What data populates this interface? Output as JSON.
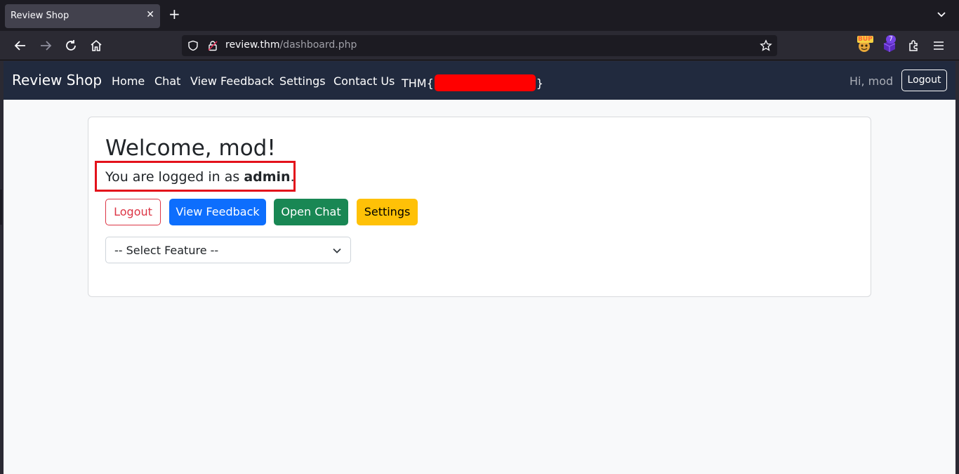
{
  "browser": {
    "tab_title": "Review Shop",
    "url_host": "review.thm",
    "url_path": "/dashboard.php",
    "extension_badge_count": "7",
    "extension_label": "BUP"
  },
  "navbar": {
    "brand": "Review Shop",
    "links": [
      "Home",
      "Chat",
      "View Feedback",
      "Settings",
      "Contact Us"
    ],
    "flag_prefix": "THM{",
    "flag_suffix": "}",
    "greeting": "Hi, mod",
    "logout_label": "Logout"
  },
  "dashboard": {
    "welcome": "Welcome, mod!",
    "logged_prefix": "You are logged in as ",
    "role": "admin",
    "logged_suffix": ".",
    "buttons": {
      "logout": "Logout",
      "view_feedback": "View Feedback",
      "open_chat": "Open Chat",
      "settings": "Settings"
    },
    "feature_select": "-- Select Feature --"
  },
  "colors": {
    "navbar_bg": "#212a3e",
    "danger": "#dc3545",
    "primary": "#0d6efd",
    "success": "#198754",
    "warning": "#ffc107",
    "highlight_box": "#e3121b",
    "redaction": "#ff0000"
  }
}
